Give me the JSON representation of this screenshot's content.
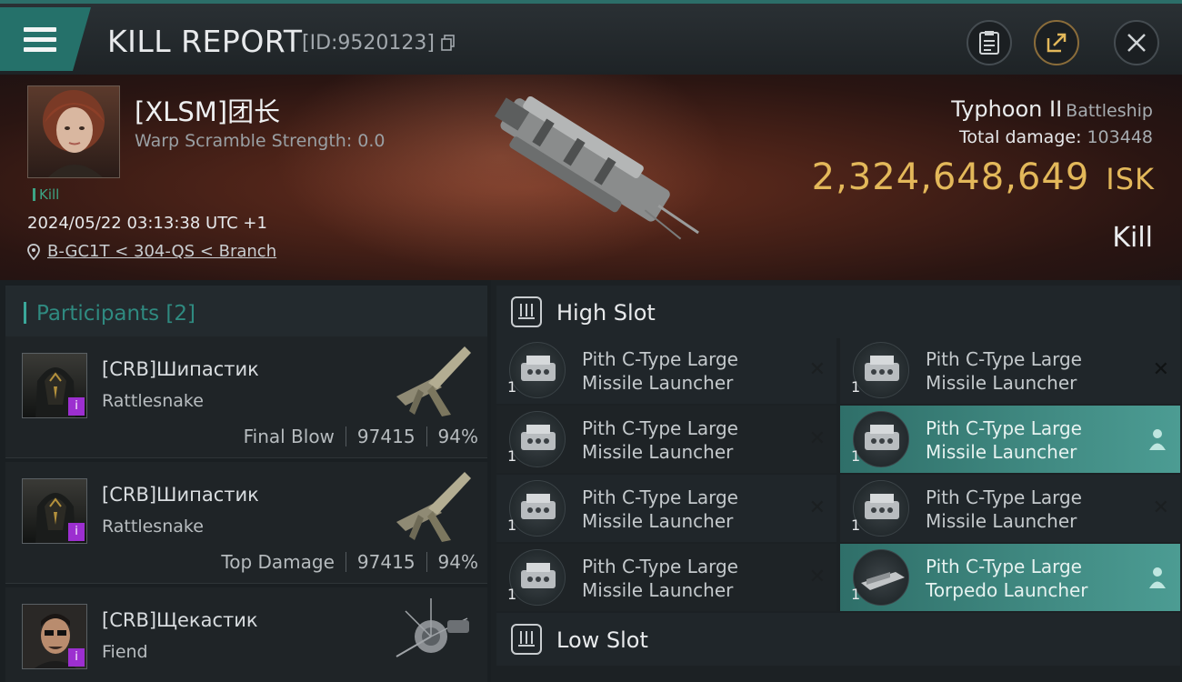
{
  "header": {
    "title": "KILL REPORT",
    "id_label": "[ID:9520123]",
    "menu_icon": "hamburger-icon",
    "actions": [
      "clipboard-icon",
      "share-icon",
      "close-icon"
    ]
  },
  "victim": {
    "name": "[XLSM]团长",
    "warp_scramble": "Warp Scramble Strength: 0.0",
    "tag": "Kill",
    "datetime": "2024/05/22 03:13:38 UTC +1",
    "location": "B-GC1T < 304-QS < Branch",
    "ship_name": "Typhoon II",
    "ship_class": "Battleship",
    "total_damage_label": "Total damage:",
    "total_damage_value": "103448",
    "isk_value": "2,324,648,649",
    "isk_unit": "ISK",
    "result": "Kill"
  },
  "participants": {
    "title": "Participants [2]",
    "rows": [
      {
        "name": "[CRB]Шипастик",
        "ship": "Rattlesnake",
        "role": "Final Blow",
        "damage": "97415",
        "percent": "94%"
      },
      {
        "name": "[CRB]Шипастик",
        "ship": "Rattlesnake",
        "role": "Top Damage",
        "damage": "97415",
        "percent": "94%"
      },
      {
        "name": "[CRB]Щекастик",
        "ship": "Fiend",
        "role": "",
        "damage": "",
        "percent": ""
      }
    ]
  },
  "slots": {
    "high_slot_label": "High Slot",
    "low_slot_label": "Low Slot",
    "modules": [
      {
        "line1": "Pith C-Type Large",
        "line2": "Missile Launcher",
        "qty": "1",
        "status": "destroyed"
      },
      {
        "line1": "Pith C-Type Large",
        "line2": "Missile Launcher",
        "qty": "1",
        "status": "destroyed"
      },
      {
        "line1": "Pith C-Type Large",
        "line2": "Missile Launcher",
        "qty": "1",
        "status": "destroyed"
      },
      {
        "line1": "Pith C-Type Large",
        "line2": "Missile Launcher",
        "qty": "1",
        "status": "dropped"
      },
      {
        "line1": "Pith C-Type Large",
        "line2": "Missile Launcher",
        "qty": "1",
        "status": "destroyed"
      },
      {
        "line1": "Pith C-Type Large",
        "line2": "Missile Launcher",
        "qty": "1",
        "status": "destroyed"
      },
      {
        "line1": "Pith C-Type Large",
        "line2": "Missile Launcher",
        "qty": "1",
        "status": "destroyed"
      },
      {
        "line1": "Pith C-Type Large",
        "line2": "Torpedo Launcher",
        "qty": "1",
        "status": "dropped"
      }
    ]
  },
  "colors": {
    "accent_teal": "#25716a",
    "isk_gold": "#e3b85a",
    "highlight": "#4c9c93",
    "badge_purple": "#9c2fd0"
  }
}
